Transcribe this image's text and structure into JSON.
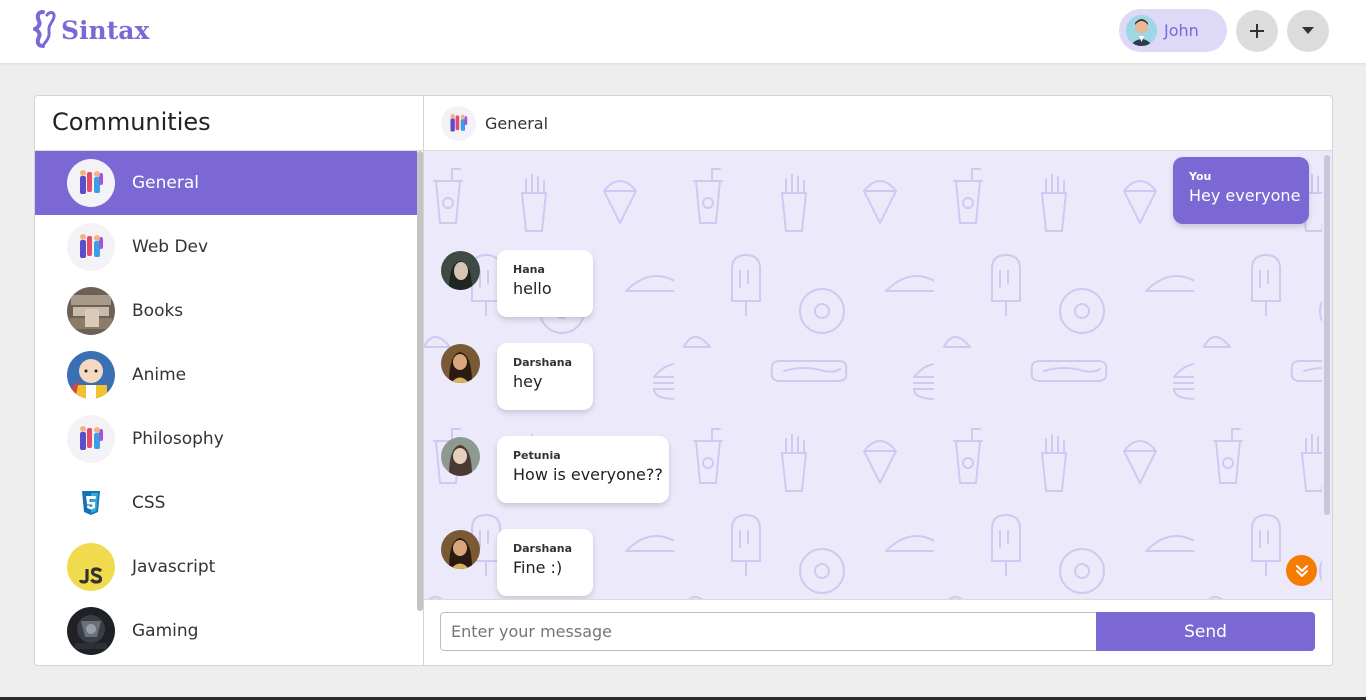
{
  "brand": {
    "name": "Sintax",
    "color": "#7b68d4"
  },
  "user": {
    "name": "John"
  },
  "header": {
    "add_icon": "plus-icon",
    "menu_icon": "caret-down-icon"
  },
  "sidebar": {
    "title": "Communities",
    "items": [
      {
        "label": "General",
        "active": true,
        "icon": "general-avatar"
      },
      {
        "label": "Web Dev",
        "active": false,
        "icon": "webdev-avatar"
      },
      {
        "label": "Books",
        "active": false,
        "icon": "books-avatar"
      },
      {
        "label": "Anime",
        "active": false,
        "icon": "anime-avatar"
      },
      {
        "label": "Philosophy",
        "active": false,
        "icon": "philosophy-avatar"
      },
      {
        "label": "CSS",
        "active": false,
        "icon": "css3-icon"
      },
      {
        "label": "Javascript",
        "active": false,
        "icon": "js-icon"
      },
      {
        "label": "Gaming",
        "active": false,
        "icon": "gaming-avatar"
      }
    ]
  },
  "chat": {
    "title": "General",
    "messages": [
      {
        "sender": "You",
        "text": "Hey everyone",
        "mine": true
      },
      {
        "sender": "Hana",
        "text": "hello",
        "mine": false
      },
      {
        "sender": "Darshana",
        "text": "hey",
        "mine": false
      },
      {
        "sender": "Petunia",
        "text": "How is everyone??",
        "mine": false
      },
      {
        "sender": "Darshana",
        "text": "Fine :)",
        "mine": false
      }
    ],
    "scroll_icon": "double-chevron-down-icon"
  },
  "composer": {
    "placeholder": "Enter your message",
    "send_label": "Send"
  },
  "colors": {
    "accent": "#7b68d4",
    "chat_bg": "#ece9fb",
    "scroll_button": "#f57c00"
  }
}
